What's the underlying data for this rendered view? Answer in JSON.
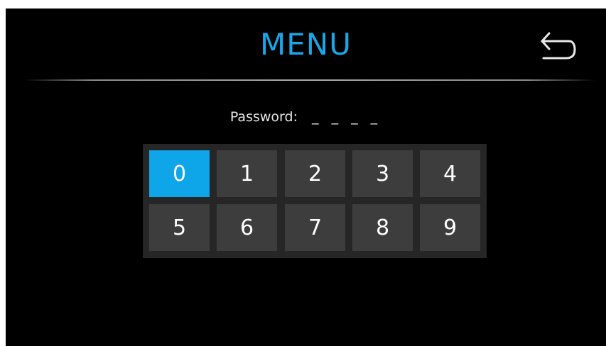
{
  "header": {
    "title": "MENU",
    "back_icon": "back-arrow-icon"
  },
  "password": {
    "label": "Password:",
    "value": "_ _ _ _"
  },
  "keypad": {
    "selected_key": "0",
    "keys": [
      "0",
      "1",
      "2",
      "3",
      "4",
      "5",
      "6",
      "7",
      "8",
      "9"
    ]
  },
  "colors": {
    "accent": "#1aa7e8",
    "selected_key": "#0ea5e9",
    "key": "#3d3d3d",
    "background": "#000000"
  }
}
